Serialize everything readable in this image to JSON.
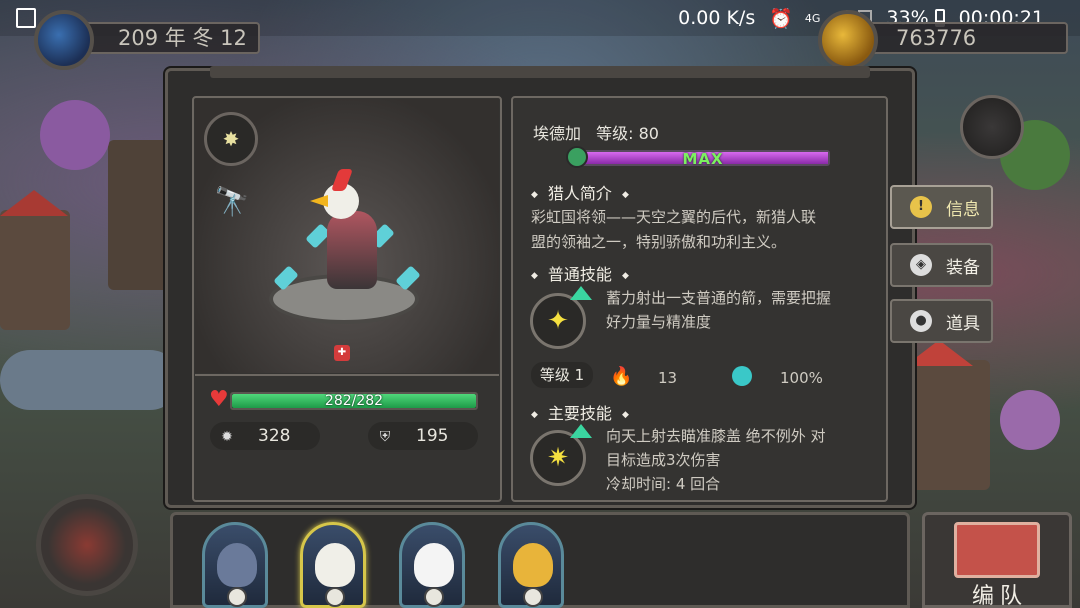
{
  "status_bar": {
    "speed": "0.00 K/s",
    "network": "4G",
    "battery": "33%",
    "time": "00:00:21"
  },
  "top_bar": {
    "date": "209 年 冬 12",
    "gold": "763776"
  },
  "hero": {
    "name": "埃德加",
    "level_label": "等级: 80",
    "xp_text": "MAX",
    "xp_fraction": 1.0,
    "hp_text": "282/282",
    "hp_fraction": 1.0,
    "attack": "328",
    "defense": "195"
  },
  "bio": {
    "title": "猎人简介",
    "line1": "彩虹国将领——天空之翼的后代，新猎人联",
    "line2": "盟的领袖之一，特别骄傲和功利主义。"
  },
  "normal_skill": {
    "title": "普通技能",
    "line1": "蓄力射出一支普通的箭，需要把握",
    "line2": "好力量与精准度",
    "level": "等级 1",
    "value1": "13",
    "value2": "100%"
  },
  "main_skill": {
    "title": "主要技能",
    "line1": "向天上射去瞄准膝盖 绝不例外 对",
    "line2": "目标造成3次伤害",
    "cooldown": "冷却时间: 4 回合"
  },
  "tabs": [
    {
      "label": "信息",
      "icon": "info-icon",
      "active": true
    },
    {
      "label": "装备",
      "icon": "armor-icon",
      "active": false
    },
    {
      "label": "道具",
      "icon": "bag-icon",
      "active": false
    }
  ],
  "team_button": {
    "label": "编队"
  },
  "colors": {
    "hp": "#1e9a48",
    "xp": "#8a2aa8",
    "max_text": "#7cf060",
    "selected_slot": "#d6c64a"
  }
}
